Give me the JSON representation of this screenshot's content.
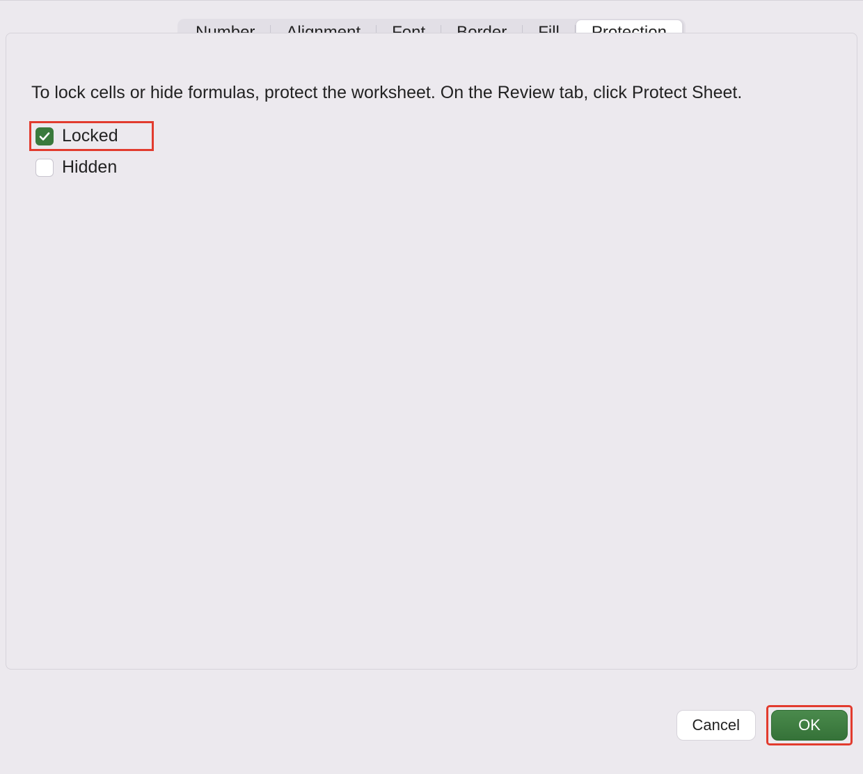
{
  "tabs": [
    {
      "label": "Number",
      "active": false
    },
    {
      "label": "Alignment",
      "active": false
    },
    {
      "label": "Font",
      "active": false
    },
    {
      "label": "Border",
      "active": false
    },
    {
      "label": "Fill",
      "active": false
    },
    {
      "label": "Protection",
      "active": true
    }
  ],
  "panel": {
    "info_text": "To lock cells or hide formulas, protect the worksheet. On the Review tab, click Protect Sheet.",
    "locked": {
      "label": "Locked",
      "checked": true,
      "highlighted": true
    },
    "hidden": {
      "label": "Hidden",
      "checked": false,
      "highlighted": false
    }
  },
  "footer": {
    "cancel_label": "Cancel",
    "ok_label": "OK",
    "ok_highlighted": true
  },
  "colors": {
    "accent_green": "#3a7a3c",
    "highlight_red": "#e23b2e"
  }
}
